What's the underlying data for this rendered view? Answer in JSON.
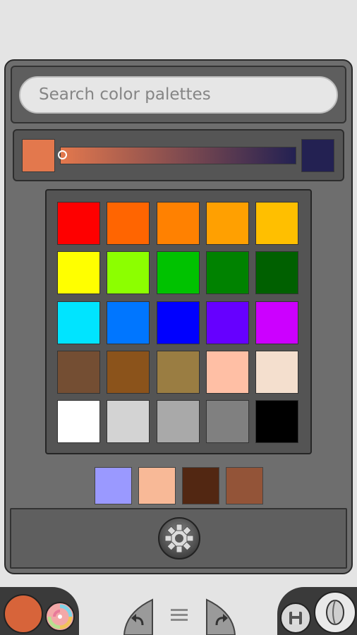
{
  "search": {
    "placeholder": "Search color palettes"
  },
  "gradient": {
    "start_color": "#e3784d",
    "end_color": "#232152"
  },
  "palette": {
    "rows": [
      [
        "#fe0000",
        "#ff6501",
        "#ff8101",
        "#ffa001",
        "#ffbf00"
      ],
      [
        "#ffff00",
        "#8cff00",
        "#00c200",
        "#008200",
        "#006000"
      ],
      [
        "#00e4ff",
        "#0076ff",
        "#0000ff",
        "#6600ff",
        "#cc00ff"
      ],
      [
        "#744e33",
        "#8b531b",
        "#9a7d42",
        "#ffbfa5",
        "#f4dfce"
      ],
      [
        "#ffffff",
        "#d3d3d3",
        "#a9a9a9",
        "#808080",
        "#000000"
      ]
    ]
  },
  "recent_colors": [
    "#9a99ff",
    "#f8b997",
    "#522712",
    "#935438"
  ],
  "toolbar": {
    "current_color": "#d7643a",
    "icons": [
      "color-swirl-icon",
      "undo-icon",
      "menu-icon",
      "redo-icon",
      "save-icon",
      "brush-icon",
      "gear-icon"
    ]
  }
}
